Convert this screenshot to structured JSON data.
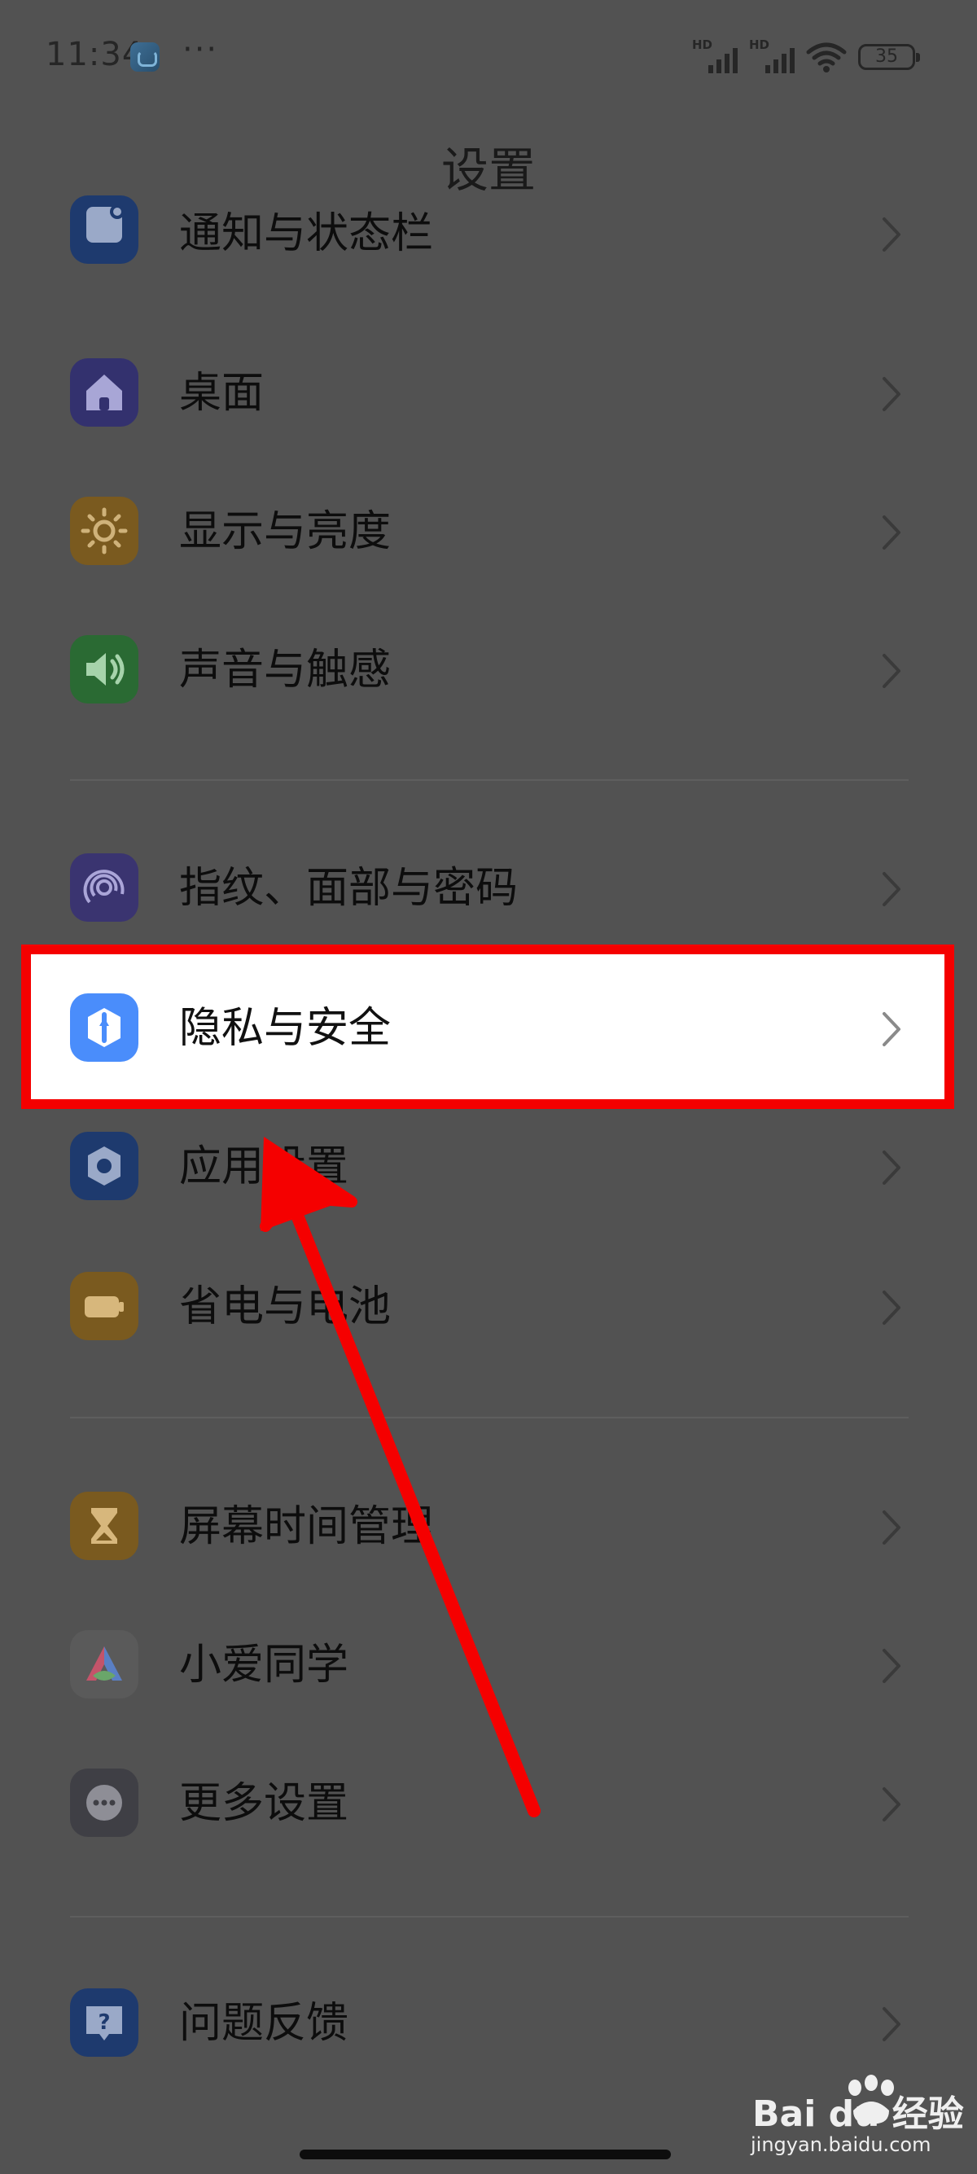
{
  "status_bar": {
    "time": "11:34",
    "more": "···",
    "signal1_label": "HD",
    "signal2_label": "HD",
    "battery": "35"
  },
  "page": {
    "title": "设置"
  },
  "settings": {
    "group1": [
      {
        "label": "通知与状态栏",
        "icon": "notification-icon",
        "color": "#1e3a6e"
      },
      {
        "label": "桌面",
        "icon": "home-icon",
        "color": "#33316e"
      },
      {
        "label": "显示与亮度",
        "icon": "sun-icon",
        "color": "#7a5a1f"
      },
      {
        "label": "声音与触感",
        "icon": "speaker-icon",
        "color": "#2a6a33"
      }
    ],
    "group2": [
      {
        "label": "指纹、面部与密码",
        "icon": "fingerprint-icon",
        "color": "#3a3470"
      },
      {
        "label": "隐私与安全",
        "icon": "privacy-shield-icon",
        "color": "#4a8dfb"
      },
      {
        "label": "应用设置",
        "icon": "app-settings-icon",
        "color": "#1e3a6e"
      },
      {
        "label": "省电与电池",
        "icon": "battery-icon",
        "color": "#7a5a1f"
      }
    ],
    "group3": [
      {
        "label": "屏幕时间管理",
        "icon": "hourglass-icon",
        "color": "#7a5a1f"
      },
      {
        "label": "小爱同学",
        "icon": "xiaoai-icon",
        "color": "#5a5a5a"
      },
      {
        "label": "更多设置",
        "icon": "more-icon",
        "color": "#3f3f45"
      }
    ],
    "group4": [
      {
        "label": "问题反馈",
        "icon": "feedback-icon",
        "color": "#1e3a6e"
      }
    ]
  },
  "annotation": {
    "highlight_color": "#f50000",
    "arrow_color": "#f50000"
  },
  "watermark": {
    "brand": "Bai du 经验",
    "url": "jingyan.baidu.com"
  }
}
